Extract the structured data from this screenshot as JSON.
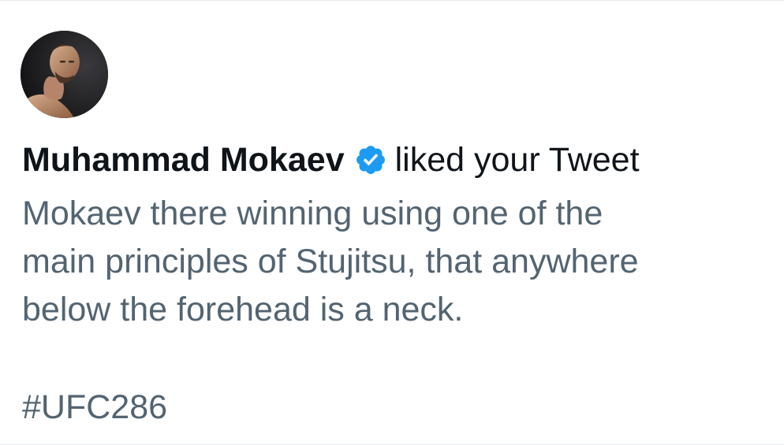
{
  "notification": {
    "user_name": "Muhammad Mokaev",
    "verified_icon": "verified-badge-icon",
    "action_text": "liked your Tweet",
    "tweet_lines": [
      "Mokaev there winning using one of the",
      "main principles of Stujitsu, that anywhere",
      "below the forehead is a neck."
    ],
    "hashtag": "#UFC286"
  },
  "colors": {
    "name_text": "#0f1419",
    "body_text": "#536471",
    "verified_blue": "#1d9bf0",
    "divider": "#e6e9ec",
    "background": "#ffffff"
  }
}
